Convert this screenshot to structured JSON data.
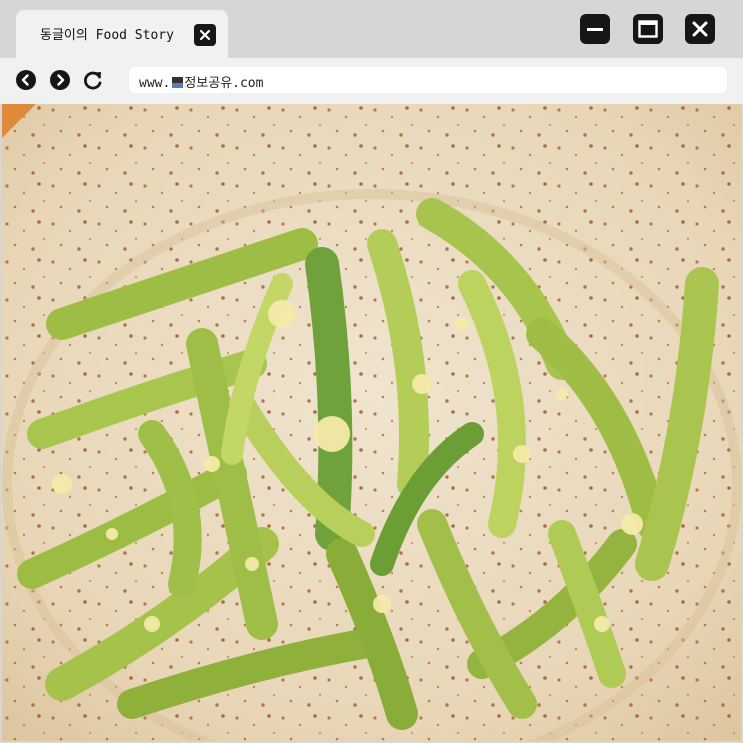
{
  "tab": {
    "title": "동글이의 Food Story"
  },
  "address_bar": {
    "url_prefix": "www.",
    "url_suffix": "정보공유.com"
  },
  "icons": {
    "tab_close": "close-icon",
    "minimize": "minimize-icon",
    "maximize": "maximize-icon",
    "window_close": "close-icon",
    "back": "back-arrow-icon",
    "forward": "forward-arrow-icon",
    "reload": "reload-icon"
  },
  "content": {
    "image": "stir-fried green pepper strips with garlic on a speckled beige ceramic plate"
  },
  "colors": {
    "chrome": "#d6d6d6",
    "tab": "#f1f1f1",
    "button": "#161616"
  }
}
